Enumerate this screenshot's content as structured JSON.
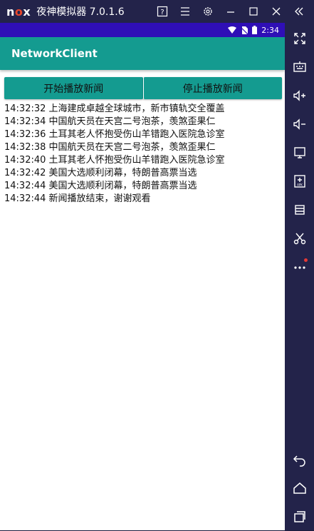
{
  "emulator": {
    "logo": {
      "n": "n",
      "o": "o",
      "x": "x"
    },
    "title": "夜神模拟器 7.0.1.6"
  },
  "status": {
    "time": "2:34"
  },
  "app": {
    "title": "NetworkClient",
    "start_label": "开始播放新闻",
    "stop_label": "停止播放新闻"
  },
  "log": [
    "14:32:32 上海建成卓越全球城市，新市镇轨交全覆盖",
    "14:32:34 中国航天员在天宫二号泡茶，羡煞歪果仁",
    "14:32:36 土耳其老人怀抱受伤山羊错跑入医院急诊室",
    "14:32:38 中国航天员在天宫二号泡茶，羡煞歪果仁",
    "14:32:40 土耳其老人怀抱受伤山羊错跑入医院急诊室",
    "14:32:42 美国大选顺利闭幕，特朗普高票当选",
    "14:32:44 美国大选顺利闭幕，特朗普高票当选",
    "14:32:44 新闻播放结束，谢谢观看"
  ],
  "colors": {
    "accent": "#149b90",
    "statusbar": "#2f0fb6",
    "emulator_chrome": "#23234a"
  }
}
